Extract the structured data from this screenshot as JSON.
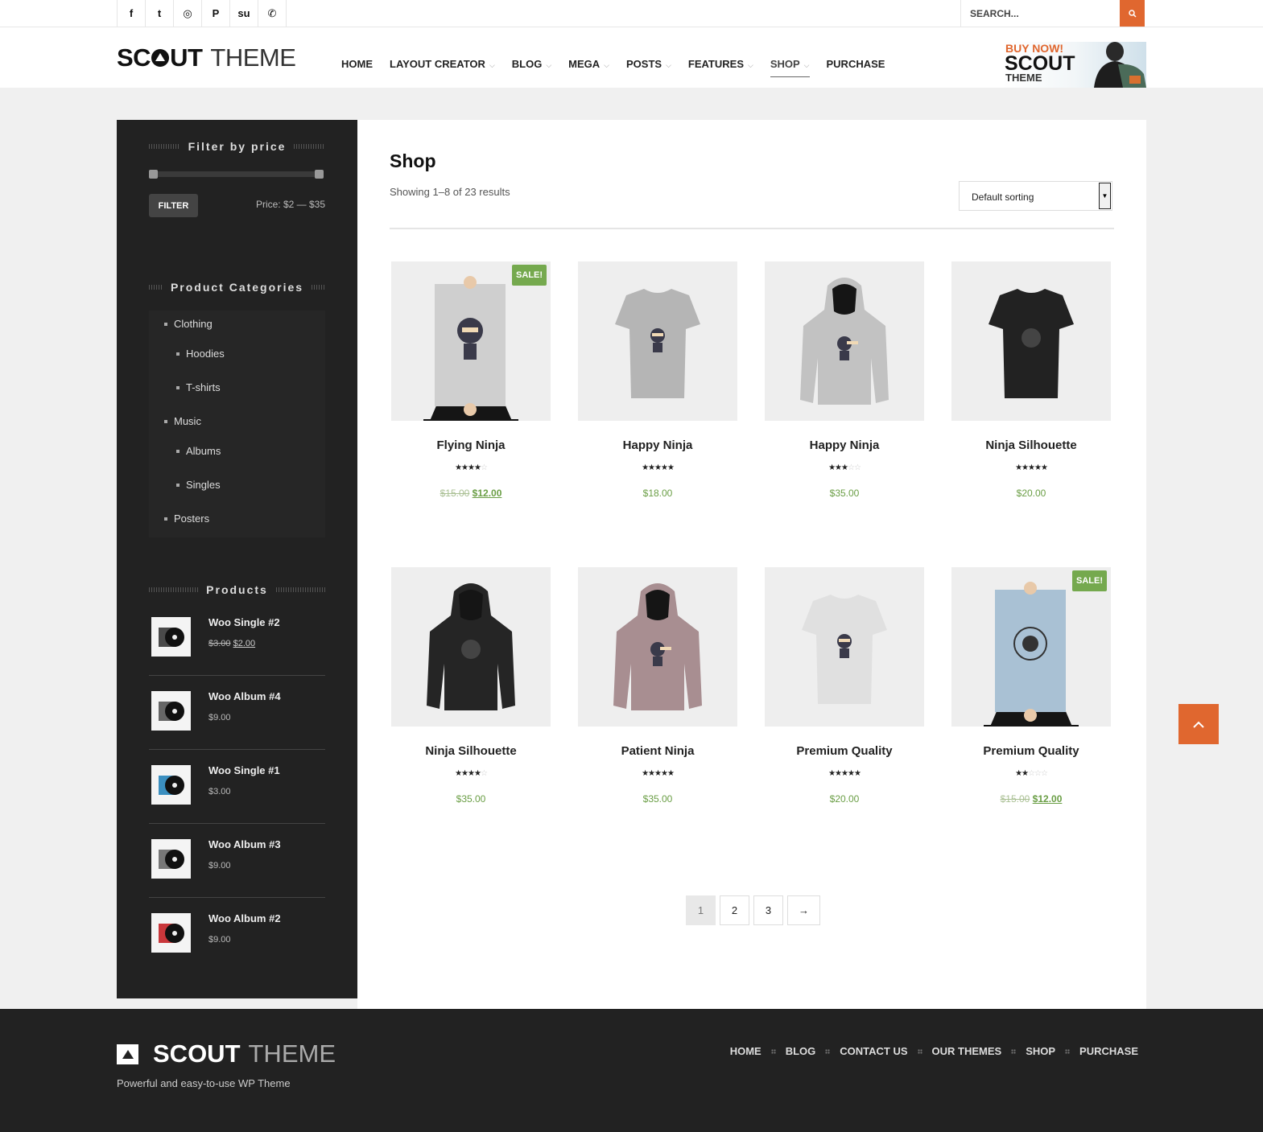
{
  "topbar": {
    "social": [
      {
        "icon": "facebook-icon",
        "glyph": "f"
      },
      {
        "icon": "twitter-icon",
        "glyph": "t"
      },
      {
        "icon": "instagram-icon",
        "glyph": "◎"
      },
      {
        "icon": "pinterest-icon",
        "glyph": "P"
      },
      {
        "icon": "stumbleupon-icon",
        "glyph": "su"
      },
      {
        "icon": "whatsapp-icon",
        "glyph": "✆"
      }
    ],
    "search_placeholder": "SEARCH..."
  },
  "header": {
    "logo_bold_a": "SC",
    "logo_bold_b": "UT",
    "logo_light": "THEME",
    "nav": [
      {
        "label": "HOME",
        "dropdown": false,
        "active": false
      },
      {
        "label": "LAYOUT CREATOR",
        "dropdown": true,
        "active": false
      },
      {
        "label": "BLOG",
        "dropdown": true,
        "active": false
      },
      {
        "label": "MEGA",
        "dropdown": true,
        "active": false
      },
      {
        "label": "POSTS",
        "dropdown": true,
        "active": false
      },
      {
        "label": "FEATURES",
        "dropdown": true,
        "active": false
      },
      {
        "label": "SHOP",
        "dropdown": true,
        "active": true
      },
      {
        "label": "PURCHASE",
        "dropdown": false,
        "active": false
      }
    ],
    "banner": {
      "line1": "BUY NOW!",
      "line2": "SCOUT",
      "line3": "THEME"
    }
  },
  "sidebar": {
    "filter_title": "Filter by price",
    "filter_button": "FILTER",
    "price_label": "Price: $2 — $35",
    "categories_title": "Product Categories",
    "categories": [
      {
        "label": "Clothing",
        "level": 0
      },
      {
        "label": "Hoodies",
        "level": 1
      },
      {
        "label": "T-shirts",
        "level": 1
      },
      {
        "label": "Music",
        "level": 0
      },
      {
        "label": "Albums",
        "level": 1
      },
      {
        "label": "Singles",
        "level": 1
      },
      {
        "label": "Posters",
        "level": 0
      }
    ],
    "products_title": "Products",
    "products": [
      {
        "name": "Woo Single #2",
        "old_price": "$3.00",
        "price": "$2.00",
        "disc_color": "#4a4a4a"
      },
      {
        "name": "Woo Album #4",
        "old_price": "",
        "price": "$9.00",
        "disc_color": "#666666"
      },
      {
        "name": "Woo Single #1",
        "old_price": "",
        "price": "$3.00",
        "disc_color": "#3b8fc0"
      },
      {
        "name": "Woo Album #3",
        "old_price": "",
        "price": "$9.00",
        "disc_color": "#777777"
      },
      {
        "name": "Woo Album #2",
        "old_price": "",
        "price": "$9.00",
        "disc_color": "#c9373b"
      }
    ]
  },
  "shop": {
    "title": "Shop",
    "result_count": "Showing 1–8 of 23 results",
    "sorting": "Default sorting",
    "sale_label": "SALE!",
    "products": [
      {
        "name": "Flying Ninja",
        "rating": 4,
        "old_price": "$15.00",
        "price": "$12.00",
        "sale": true,
        "kind": "poster",
        "color": "#cfcfcf"
      },
      {
        "name": "Happy Ninja",
        "rating": 5,
        "old_price": "",
        "price": "$18.00",
        "sale": false,
        "kind": "tshirt",
        "color": "#b5b5b5"
      },
      {
        "name": "Happy Ninja",
        "rating": 3,
        "old_price": "",
        "price": "$35.00",
        "sale": false,
        "kind": "hoodie",
        "color": "#c2c2c2"
      },
      {
        "name": "Ninja Silhouette",
        "rating": 5,
        "old_price": "",
        "price": "$20.00",
        "sale": false,
        "kind": "tshirt",
        "color": "#222222"
      },
      {
        "name": "Ninja Silhouette",
        "rating": 4,
        "old_price": "",
        "price": "$35.00",
        "sale": false,
        "kind": "hoodie",
        "color": "#252525"
      },
      {
        "name": "Patient Ninja",
        "rating": 5,
        "old_price": "",
        "price": "$35.00",
        "sale": false,
        "kind": "hoodie",
        "color": "#a88e91"
      },
      {
        "name": "Premium Quality",
        "rating": 5,
        "old_price": "",
        "price": "$20.00",
        "sale": false,
        "kind": "tshirt",
        "color": "#e0e0e0"
      },
      {
        "name": "Premium Quality",
        "rating": 2,
        "old_price": "$15.00",
        "price": "$12.00",
        "sale": true,
        "kind": "poster",
        "color": "#a9c1d4"
      }
    ],
    "pagination": [
      "1",
      "2",
      "3",
      "→"
    ]
  },
  "footer": {
    "logo_bold": "SCOUT",
    "logo_light": "THEME",
    "tagline": "Powerful and easy-to-use WP Theme",
    "nav": [
      "HOME",
      "BLOG",
      "CONTACT US",
      "OUR THEMES",
      "SHOP",
      "PURCHASE"
    ]
  },
  "colors": {
    "accent": "#e0672f",
    "sale": "#75a94e",
    "price": "#6a9e45",
    "dark": "#222222"
  }
}
